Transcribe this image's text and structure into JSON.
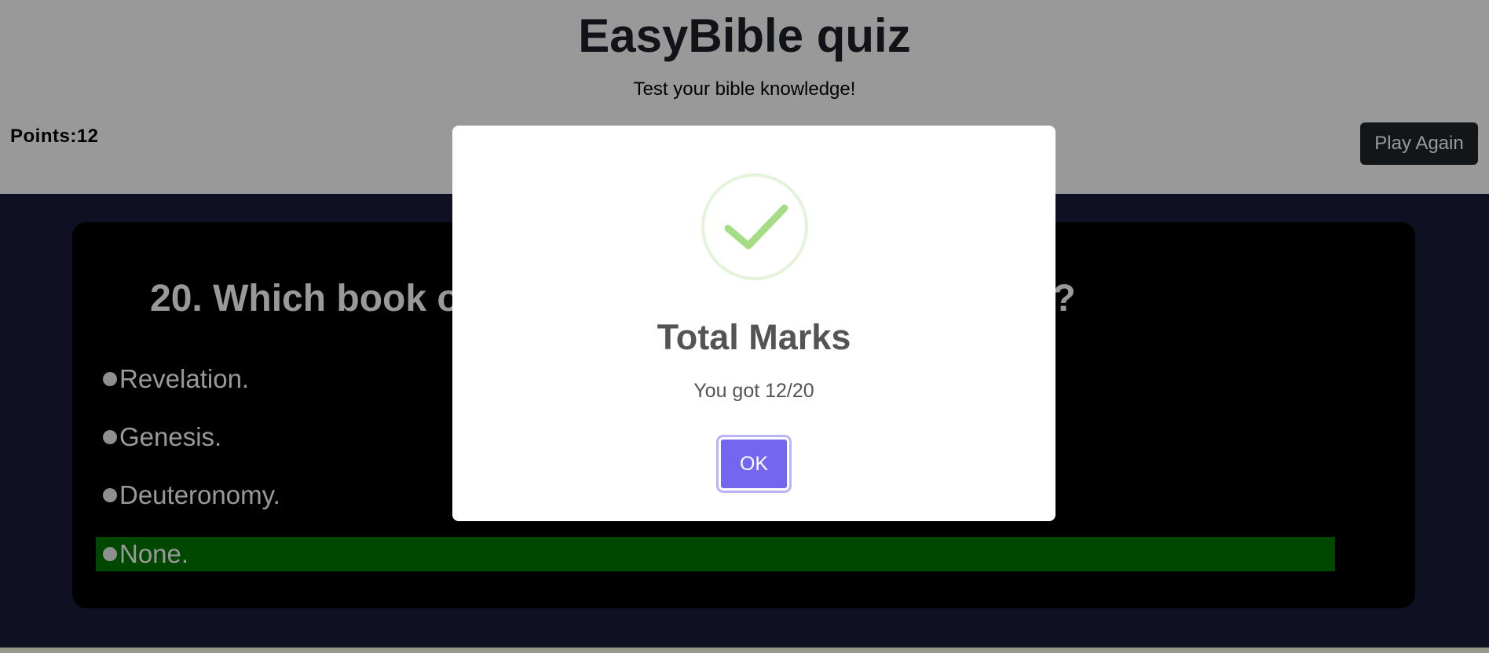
{
  "header": {
    "title": "EasyBible quiz",
    "subtitle": "Test your bible knowledge!",
    "points_label": "Points:12",
    "play_again_label": "Play Again"
  },
  "question": {
    "text": "20. Which book of the Bible does not mention God?",
    "options": [
      {
        "label": "Revelation.",
        "state": "normal"
      },
      {
        "label": "Genesis.",
        "state": "normal"
      },
      {
        "label": "Deuteronomy.",
        "state": "normal"
      },
      {
        "label": "None.",
        "state": "correct"
      }
    ]
  },
  "modal": {
    "icon": "success-check-icon",
    "title": "Total Marks",
    "text": "You got 12/20",
    "ok_label": "OK"
  },
  "colors": {
    "header_bg": "#ffffff",
    "page_bg": "#1a1c38",
    "card_bg": "#000000",
    "correct_option_bg": "#007700",
    "ok_button": "#7367f0",
    "success_green": "#a5dc86"
  }
}
